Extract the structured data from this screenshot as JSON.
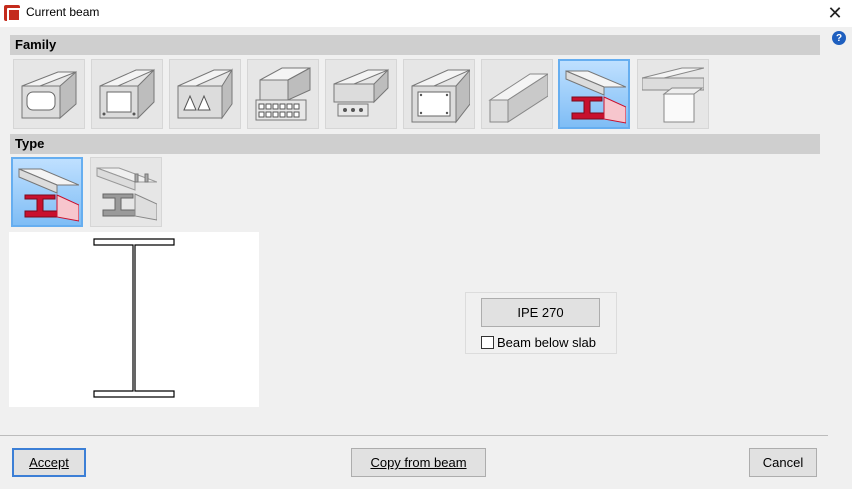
{
  "window": {
    "title": "Current beam"
  },
  "sections": {
    "family": "Family",
    "type": "Type"
  },
  "family_tiles": [
    {
      "icon": "hollow-core-slab-beam-icon"
    },
    {
      "icon": "box-beam-icon"
    },
    {
      "icon": "triangular-void-beam-icon"
    },
    {
      "icon": "cellular-beam-icon"
    },
    {
      "icon": "beam-with-openings-icon"
    },
    {
      "icon": "box-girder-icon"
    },
    {
      "icon": "rectangular-beam-icon"
    },
    {
      "icon": "steel-i-beam-icon",
      "selected": true
    },
    {
      "icon": "beam-with-column-icon"
    }
  ],
  "type_tiles": [
    {
      "icon": "steel-i-beam-icon",
      "selected": true
    },
    {
      "icon": "composite-i-beam-icon"
    }
  ],
  "profile": {
    "label": "IPE 270"
  },
  "checkbox": {
    "label": "Beam below slab",
    "checked": false
  },
  "buttons": {
    "accept": "Accept",
    "copy": "Copy from beam",
    "cancel": "Cancel"
  },
  "colors": {
    "accent": "#66aef0",
    "steel_red": "#c8102e"
  }
}
